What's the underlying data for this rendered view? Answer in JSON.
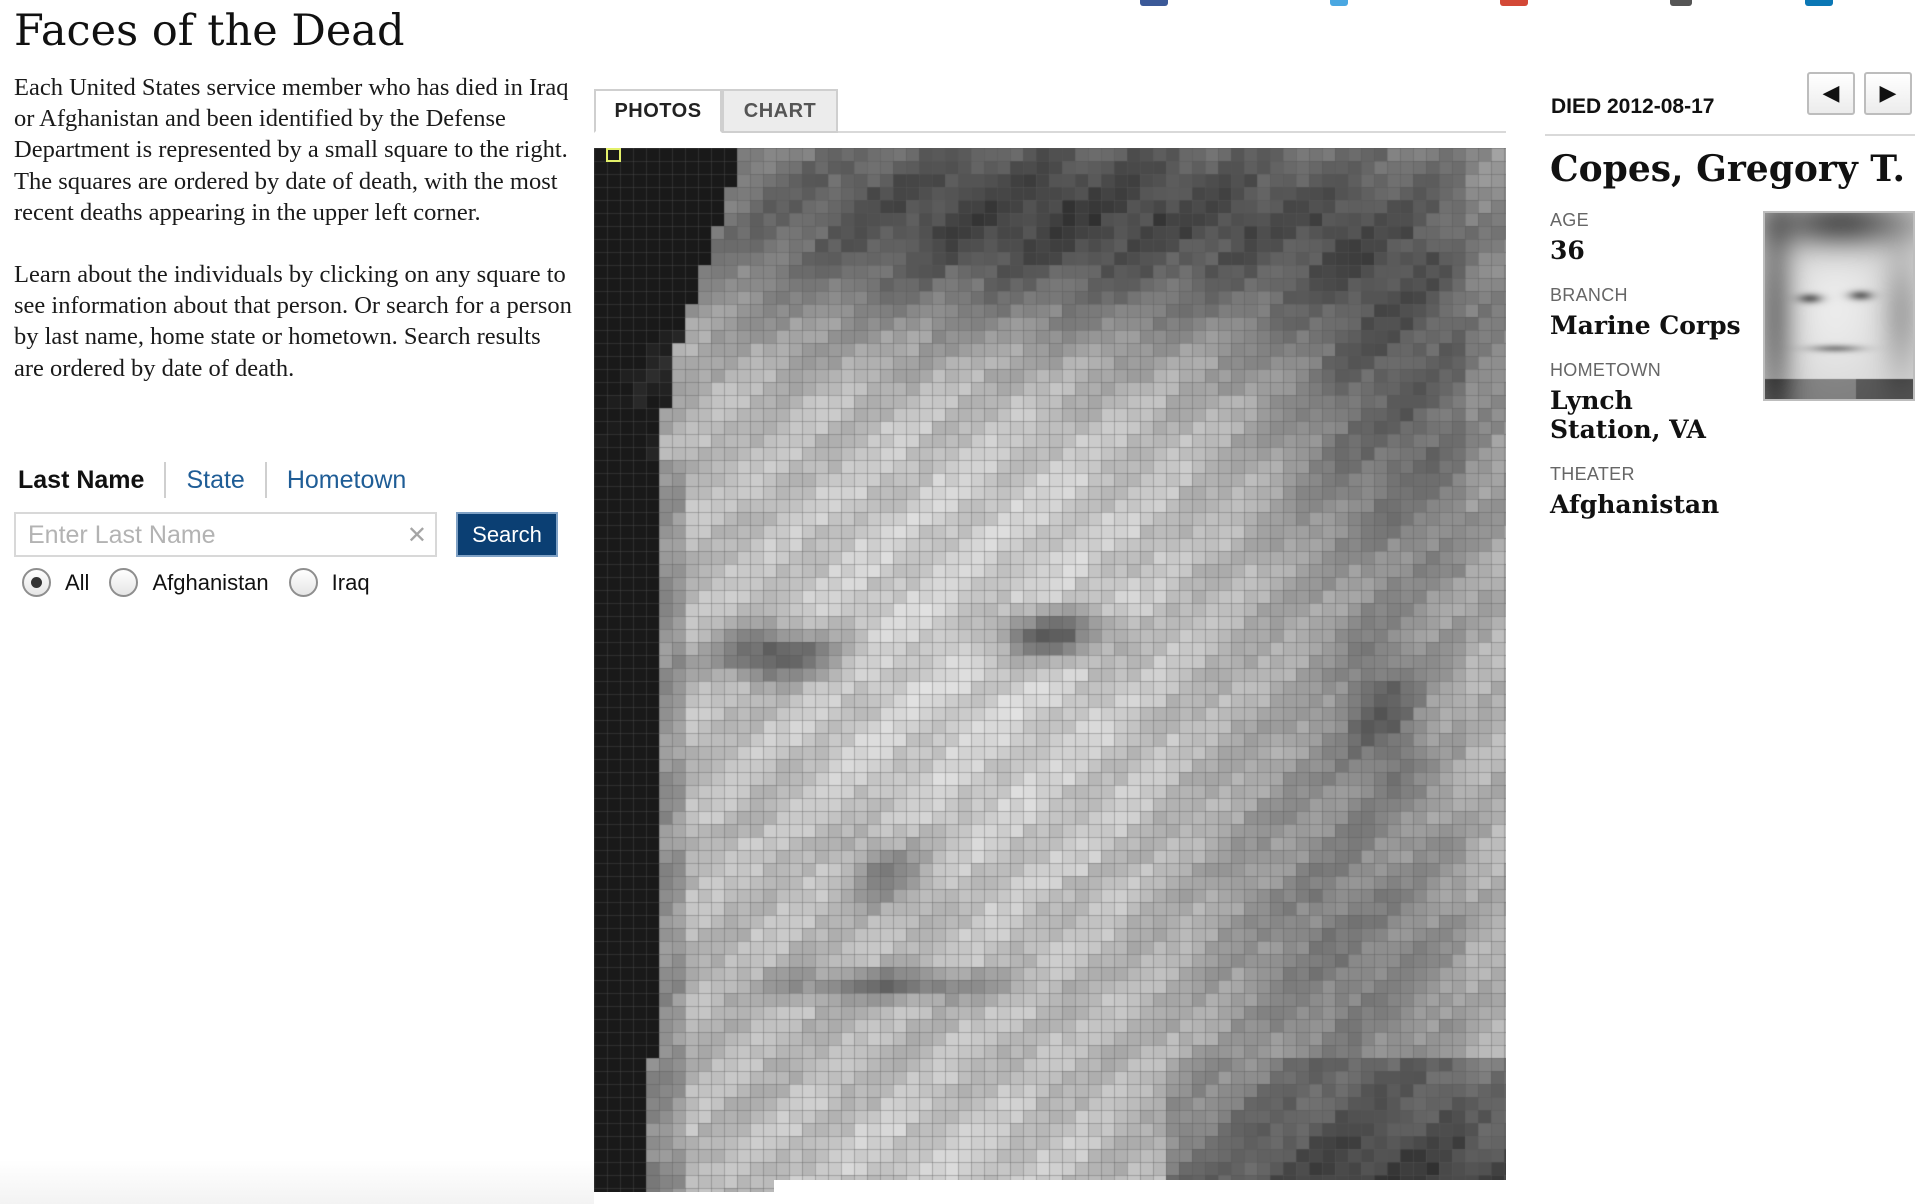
{
  "page": {
    "title": "Faces of the Dead",
    "intro_paragraph_1": "Each United States service member who has died in Iraq or Afghanistan and been identified by the Defense Department is represented by a small square to the right. The squares are ordered by date of death, with the most recent deaths appearing in the upper left corner.",
    "intro_paragraph_2": "Learn about the individuals by clicking on any square to see information about that person.  Or search for a person by last name, home state or hometown. Search results are  ordered by date of death."
  },
  "search": {
    "tabs": [
      "Last Name",
      "State",
      "Hometown"
    ],
    "active_tab": "Last Name",
    "placeholder": "Enter Last Name",
    "value": "",
    "clear_icon": "close-icon",
    "button_label": "Search",
    "filters": [
      {
        "label": "All",
        "checked": true
      },
      {
        "label": "Afghanistan",
        "checked": false
      },
      {
        "label": "Iraq",
        "checked": false
      }
    ]
  },
  "visualization": {
    "tabs": [
      "PHOTOS",
      "CHART"
    ],
    "active_tab": "PHOTOS",
    "mosaic_icon": "pixelated-grayscale-portrait"
  },
  "detail": {
    "died_text": "DIED 2012-08-17",
    "nav_prev_icon": "◀",
    "nav_next_icon": "▶",
    "name": "Copes, Gregory T.",
    "fields": [
      {
        "label": "AGE",
        "value": "36"
      },
      {
        "label": "BRANCH",
        "value": "Marine Corps"
      },
      {
        "label": "HOMETOWN",
        "value": "Lynch Station, VA"
      },
      {
        "label": "THEATER",
        "value": "Afghanistan"
      }
    ],
    "portrait_icon": "service-member-photo"
  },
  "colors": {
    "link_blue": "#1f5d96",
    "button_navy": "#0b3f73",
    "selected_square": "#e3f06a"
  }
}
